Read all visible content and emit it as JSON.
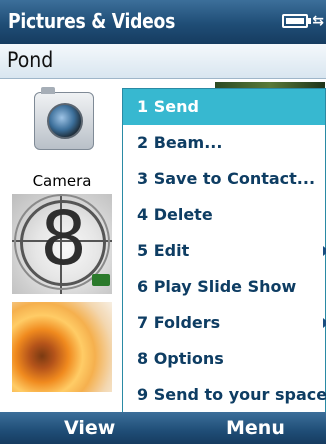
{
  "titlebar": {
    "title": "Pictures & Videos",
    "battery_icon": "battery-icon",
    "sync_icon": "arrow-icon"
  },
  "subtitle": {
    "folder": "Pond"
  },
  "thumbnails": {
    "camera_label": "Camera",
    "film_number": "8"
  },
  "menu": {
    "items": [
      {
        "label": "1 Send",
        "selected": true,
        "submenu": false
      },
      {
        "label": "2 Beam...",
        "selected": false,
        "submenu": false
      },
      {
        "label": "3 Save to Contact...",
        "selected": false,
        "submenu": false
      },
      {
        "label": "4 Delete",
        "selected": false,
        "submenu": false
      },
      {
        "label": "5 Edit",
        "selected": false,
        "submenu": true
      },
      {
        "label": "6 Play Slide Show",
        "selected": false,
        "submenu": false
      },
      {
        "label": "7 Folders",
        "selected": false,
        "submenu": true
      },
      {
        "label": "8 Options",
        "selected": false,
        "submenu": false
      },
      {
        "label": "9 Send to your space",
        "selected": false,
        "submenu": false
      }
    ]
  },
  "softkeys": {
    "left": "View",
    "right": "Menu"
  },
  "colors": {
    "title_bar": "#1f4d76",
    "menu_selected": "#37b8d0",
    "menu_text": "#0e3d63"
  }
}
